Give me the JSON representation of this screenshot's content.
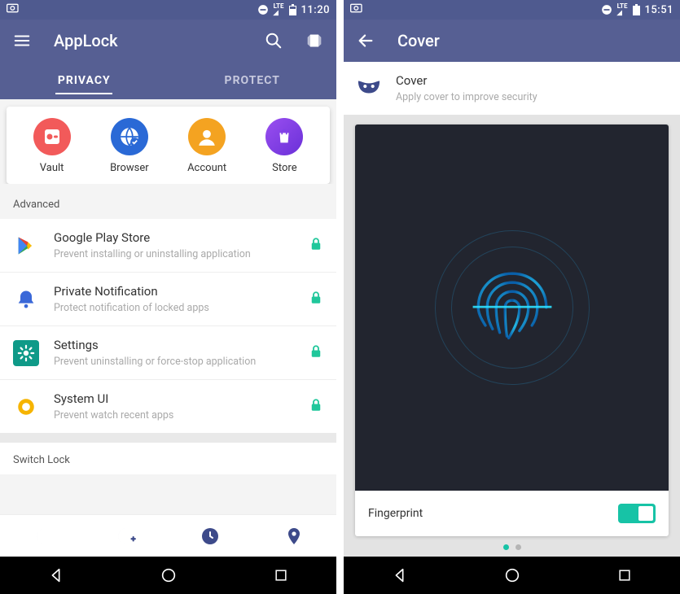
{
  "left": {
    "status": {
      "time": "11:20",
      "net": "LTE"
    },
    "title": "AppLock",
    "tabs": [
      {
        "label": "PRIVACY",
        "active": true
      },
      {
        "label": "PROTECT",
        "active": false
      }
    ],
    "quick": [
      {
        "icon": "vault-icon",
        "label": "Vault",
        "color": "#f25a5a"
      },
      {
        "icon": "browser-icon",
        "label": "Browser",
        "color": "#2a69d6"
      },
      {
        "icon": "account-icon",
        "label": "Account",
        "color": "#f4a321"
      },
      {
        "icon": "store-icon",
        "label": "Store",
        "color": "#8040e8"
      }
    ],
    "sections": {
      "advanced_label": "Advanced",
      "switch_lock_label": "Switch Lock",
      "advanced": [
        {
          "icon": "play-store-icon",
          "title": "Google Play Store",
          "sub": "Prevent installing or uninstalling application",
          "locked": true
        },
        {
          "icon": "bell-icon",
          "title": "Private Notification",
          "sub": "Protect notification of locked apps",
          "locked": true
        },
        {
          "icon": "gear-icon",
          "title": "Settings",
          "sub": "Prevent uninstalling or force-stop application",
          "locked": true
        },
        {
          "icon": "ring-icon",
          "title": "System UI",
          "sub": "Prevent watch recent apps",
          "locked": true
        }
      ]
    },
    "bottom_icons": [
      "moon-icon",
      "moon-plus-icon",
      "clock-icon",
      "location-icon"
    ]
  },
  "right": {
    "status": {
      "time": "15:51",
      "net": "LTE"
    },
    "title": "Cover",
    "header": {
      "title": "Cover",
      "sub": "Apply cover to improve security"
    },
    "card": {
      "label": "Fingerprint",
      "toggle_on": true
    },
    "pager": {
      "count": 2,
      "active": 0
    }
  },
  "colors": {
    "primary": "#565f93",
    "lock_green": "#20c79b",
    "accent": "#17c3a6",
    "bottom_icon": "#3d4a8a"
  }
}
